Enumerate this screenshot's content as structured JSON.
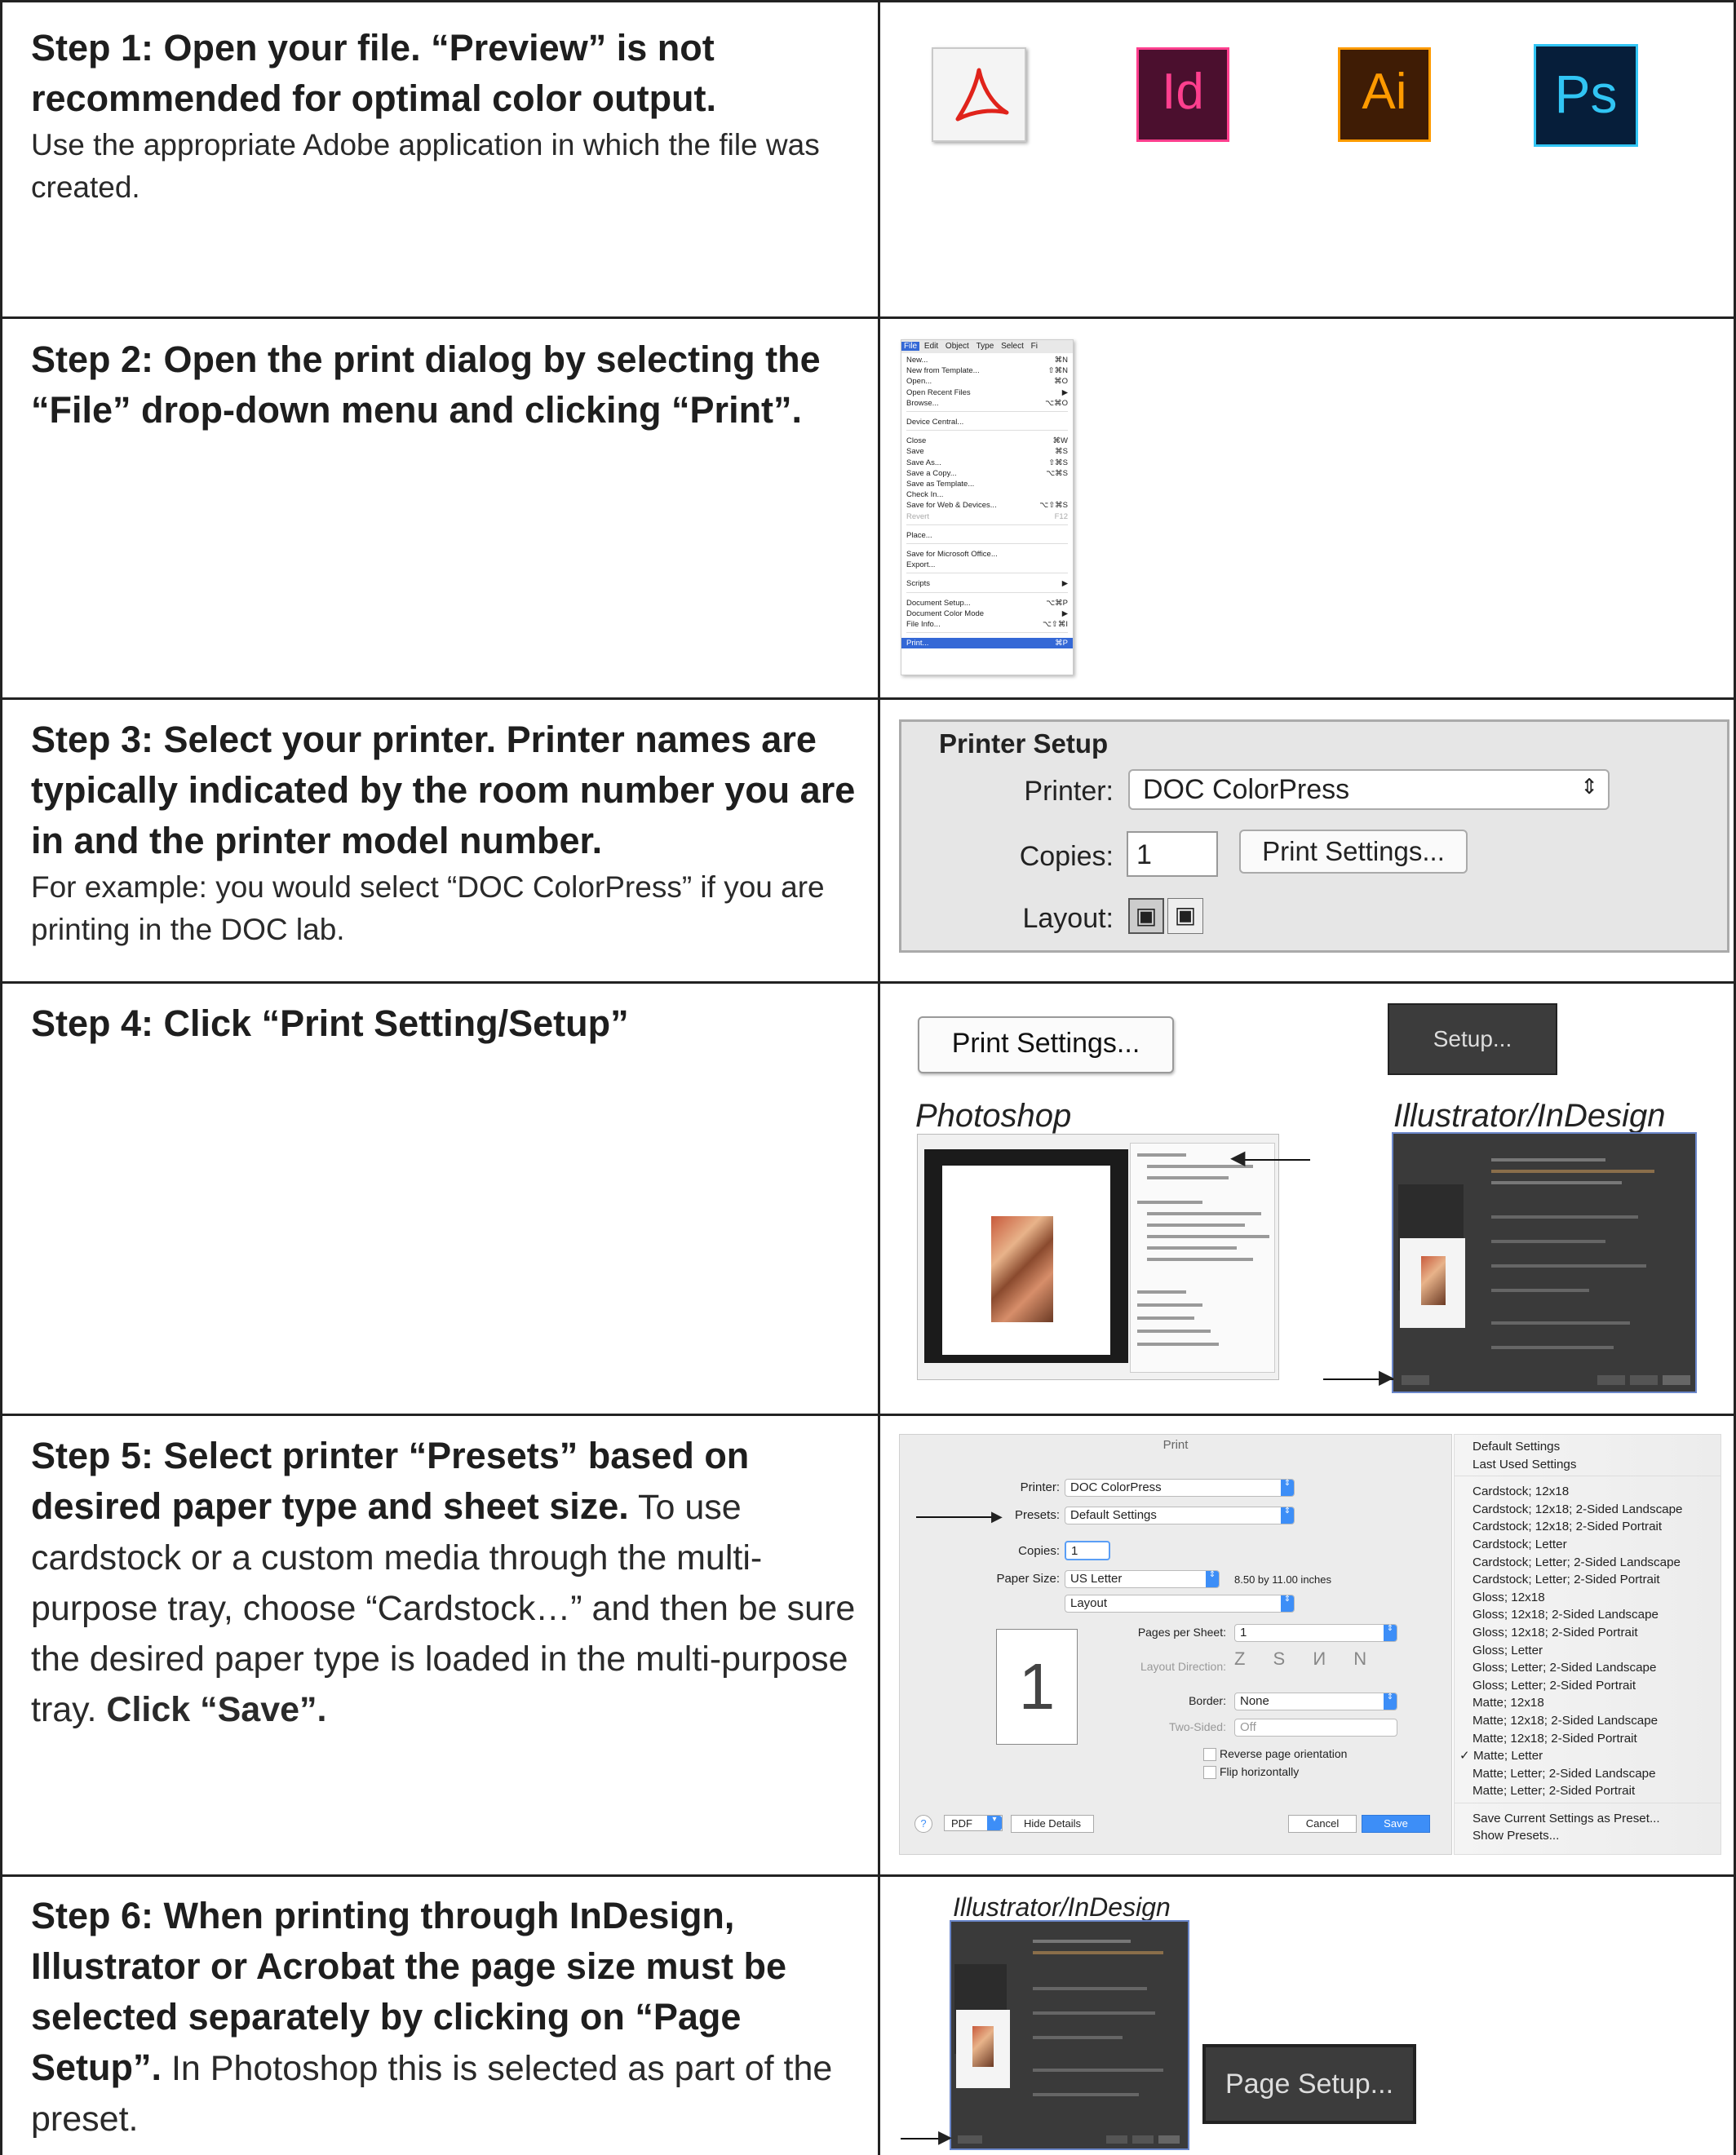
{
  "steps": [
    {
      "title": "Step 1: Open your file. “Preview” is not recommended for optimal color output.",
      "body": "Use the appropriate Adobe application in which the file was created."
    },
    {
      "title": "Step 2: Open the print dialog by selecting the “File” drop-down menu and clicking “Print”."
    },
    {
      "title": "Step 3: Select your printer. Printer names are typically indicated by the room number you are in and the printer model number.",
      "body": "For example: you would select “DOC ColorPress” if you are printing in the DOC lab."
    },
    {
      "title": "Step 4: Click “Print Setting/Setup”"
    },
    {
      "title": "Step 5: Select printer “Presets” based on desired paper type and sheet size.",
      "body_a": " To use cardstock or a custom media through the multi-purpose tray, choose “Cardstock…” and then be sure the desired paper type is loaded in the multi-purpose tray. ",
      "body_b": "Click “Save”."
    },
    {
      "title": "Step 6: When printing through InDesign, Illustrator or Acrobat the page size must be selected separately by clicking on “Page Setup”.",
      "body": " In Photoshop this is selected as part of the preset."
    }
  ],
  "apps": [
    {
      "name": "Acrobat",
      "label": "",
      "bg": "#f4f4f4",
      "fg": "#e0231b",
      "border": "#c9c9c9"
    },
    {
      "name": "InDesign",
      "label": "Id",
      "bg": "#4b0f2e",
      "fg": "#ff3f8e",
      "border": "#ff3f8e"
    },
    {
      "name": "Illustrator",
      "label": "Ai",
      "bg": "#3f1c05",
      "fg": "#ff9a00",
      "border": "#ff9a00"
    },
    {
      "name": "Photoshop",
      "label": "Ps",
      "bg": "#061e3a",
      "fg": "#31c5f4",
      "border": "#31c5f4"
    }
  ],
  "file_menu": {
    "menubar": [
      "File",
      "Edit",
      "Object",
      "Type",
      "Select",
      "Fi"
    ],
    "items": [
      {
        "label": "New...",
        "key": "⌘N"
      },
      {
        "label": "New from Template...",
        "key": "⇧⌘N"
      },
      {
        "label": "Open...",
        "key": "⌘O"
      },
      {
        "label": "Open Recent Files",
        "key": "▶"
      },
      {
        "label": "Browse...",
        "key": "⌥⌘O"
      },
      {
        "label": "",
        "key": ""
      },
      {
        "label": "Device Central...",
        "key": ""
      },
      {
        "label": "",
        "key": ""
      },
      {
        "label": "Close",
        "key": "⌘W"
      },
      {
        "label": "Save",
        "key": "⌘S"
      },
      {
        "label": "Save As...",
        "key": "⇧⌘S"
      },
      {
        "label": "Save a Copy...",
        "key": "⌥⌘S"
      },
      {
        "label": "Save as Template...",
        "key": ""
      },
      {
        "label": "Check In...",
        "key": ""
      },
      {
        "label": "Save for Web & Devices...",
        "key": "⌥⇧⌘S"
      },
      {
        "label": "Revert",
        "key": "F12"
      },
      {
        "label": "",
        "key": ""
      },
      {
        "label": "Place...",
        "key": ""
      },
      {
        "label": "",
        "key": ""
      },
      {
        "label": "Save for Microsoft Office...",
        "key": ""
      },
      {
        "label": "Export...",
        "key": ""
      },
      {
        "label": "",
        "key": ""
      },
      {
        "label": "Scripts",
        "key": "▶"
      },
      {
        "label": "",
        "key": ""
      },
      {
        "label": "Document Setup...",
        "key": "⌥⌘P"
      },
      {
        "label": "Document Color Mode",
        "key": "▶"
      },
      {
        "label": "File Info...",
        "key": "⌥⇧⌘I"
      },
      {
        "label": "",
        "key": ""
      },
      {
        "label": "Print...",
        "key": "⌘P"
      }
    ]
  },
  "printer_setup": {
    "heading": "Printer Setup",
    "printer_label": "Printer:",
    "printer_value": "DOC ColorPress",
    "copies_label": "Copies:",
    "copies_value": "1",
    "print_settings": "Print Settings...",
    "layout_label": "Layout:"
  },
  "step4": {
    "print_settings": "Print Settings...",
    "setup": "Setup...",
    "photoshop_caption": "Photoshop",
    "illustrator_caption": "Illustrator/InDesign"
  },
  "print_dialog": {
    "title": "Print",
    "printer_label": "Printer:",
    "printer_value": "DOC ColorPress",
    "presets_label": "Presets:",
    "presets_value": "Default Settings",
    "copies_label": "Copies:",
    "copies_value": "1",
    "paper_label": "Paper Size:",
    "paper_value": "US Letter",
    "paper_dims": "8.50 by 11.00 inches",
    "section": "Layout",
    "page_number": "1",
    "pps_label": "Pages per Sheet:",
    "pps_value": "1",
    "direction_label": "Layout Direction:",
    "border_label": "Border:",
    "border_value": "None",
    "twosided_label": "Two-Sided:",
    "twosided_value": "Off",
    "reverse": "Reverse page orientation",
    "flip": "Flip horizontally",
    "help": "?",
    "pdf": "PDF",
    "hide_details": "Hide Details",
    "cancel": "Cancel",
    "save": "Save"
  },
  "presets_menu": [
    "Default Settings",
    "Last Used Settings",
    "",
    "Cardstock; 12x18",
    "Cardstock; 12x18; 2-Sided Landscape",
    "Cardstock; 12x18; 2-Sided Portrait",
    "Cardstock; Letter",
    "Cardstock; Letter; 2-Sided Landscape",
    "Cardstock; Letter; 2-Sided Portrait",
    "Gloss; 12x18",
    "Gloss; 12x18; 2-Sided Landscape",
    "Gloss; 12x18; 2-Sided Portrait",
    "Gloss; Letter",
    "Gloss; Letter; 2-Sided Landscape",
    "Gloss; Letter; 2-Sided Portrait",
    "Matte; 12x18",
    "Matte; 12x18; 2-Sided Landscape",
    "Matte; 12x18; 2-Sided Portrait",
    "✓ Matte; Letter",
    "Matte; Letter; 2-Sided Landscape",
    "Matte; Letter; 2-Sided Portrait",
    "",
    "Save Current Settings as Preset...",
    "Show Presets..."
  ],
  "step6": {
    "caption": "Illustrator/InDesign",
    "page_setup": "Page Setup..."
  }
}
